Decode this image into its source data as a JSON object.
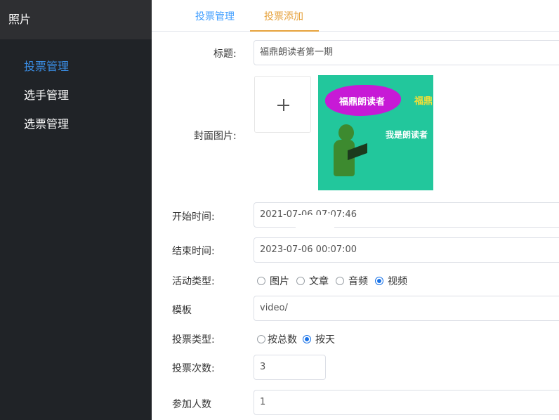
{
  "sidebar": {
    "title": "照片",
    "items": [
      {
        "label": "投票管理",
        "active": true
      },
      {
        "label": "选手管理",
        "active": false
      },
      {
        "label": "选票管理",
        "active": false
      }
    ]
  },
  "tabs": [
    {
      "label": "投票管理",
      "active": false
    },
    {
      "label": "投票添加",
      "active": true
    }
  ],
  "form": {
    "title_label": "标题:",
    "title_value": "福鼎朗读者第一期",
    "cover_label": "封面图片:",
    "cover_image": {
      "title": "福鼎朗读者",
      "side_text": "福鼎",
      "subtitle": "我是朗读者"
    },
    "start_label": "开始时间:",
    "start_value": "2021-07-06 07:07:46",
    "end_label": "结束时间:",
    "end_value": "2023-07-06 00:07:00",
    "activity_type_label": "活动类型:",
    "activity_types": [
      {
        "label": "图片",
        "checked": false
      },
      {
        "label": "文章",
        "checked": false
      },
      {
        "label": "音频",
        "checked": false
      },
      {
        "label": "视频",
        "checked": true
      }
    ],
    "template_label": "模板",
    "template_value": "video/",
    "vote_type_label": "投票类型:",
    "vote_types": [
      {
        "label": "按总数",
        "checked": false
      },
      {
        "label": "按天",
        "checked": true
      }
    ],
    "vote_count_label": "投票次数:",
    "vote_count_value": "3",
    "participants_label": "参加人数",
    "participants_value": "1"
  },
  "colors": {
    "sidebar_bg": "#202327",
    "accent_blue": "#409eff",
    "accent_orange": "#e6a23c",
    "radio_checked": "#1a73e8"
  }
}
